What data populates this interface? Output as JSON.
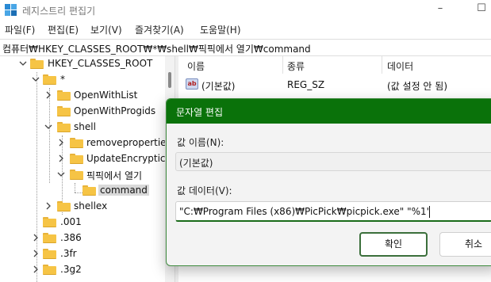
{
  "window": {
    "title": "레지스트리 편집기",
    "minimize_glyph": "–",
    "close_glyph": "☐"
  },
  "menu": [
    "파일(F)",
    "편집(E)",
    "보기(V)",
    "즐겨찾기(A)",
    "도움말(H)"
  ],
  "address": "컴퓨터₩HKEY_CLASSES_ROOT₩*₩shell₩픽픽에서 열기₩command",
  "tree": {
    "items": [
      {
        "label": "HKEY_CLASSES_ROOT",
        "expanded": true
      },
      {
        "label": "*",
        "expanded": true
      },
      {
        "label": "OpenWithList",
        "expanded": false
      },
      {
        "label": "OpenWithProgids",
        "expanded": null
      },
      {
        "label": "shell",
        "expanded": true
      },
      {
        "label": "removepropertie",
        "expanded": false
      },
      {
        "label": "UpdateEncryptic",
        "expanded": false
      },
      {
        "label": "픽픽에서 열기",
        "expanded": true
      },
      {
        "label": "command",
        "selected": true
      },
      {
        "label": "shellex",
        "expanded": false
      },
      {
        "label": ".001",
        "expanded": null
      },
      {
        "label": ".386",
        "expanded": false
      },
      {
        "label": ".3fr",
        "expanded": false
      },
      {
        "label": ".3g2",
        "expanded": false
      }
    ]
  },
  "values_pane": {
    "columns": [
      "이름",
      "종류",
      "데이터"
    ],
    "rows": [
      {
        "icon": "string-value-icon",
        "icon_text": "ab",
        "name": "(기본값)",
        "type": "REG_SZ",
        "data": "(값 설정 안 됨)"
      }
    ]
  },
  "dialog": {
    "title": "문자열 편집",
    "name_label": "값 이름(N):",
    "name_value": "(기본값)",
    "data_label": "값 데이터(V):",
    "data_value": "\"C:₩Program Files (x86)₩PicPick₩picpick.exe\" \"%1\"",
    "ok_label": "확인",
    "cancel_label": "취소"
  },
  "colors": {
    "dialog_title_bg": "#0a720a",
    "folder": "#f6c445",
    "accent_border": "#3b6f3b"
  }
}
